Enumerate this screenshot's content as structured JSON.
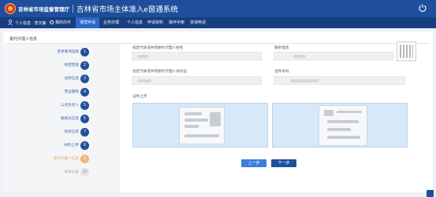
{
  "header": {
    "agency": "吉林省市场监督管理厅",
    "system_title": "吉林省市场主体准入e窗通系统"
  },
  "nav": {
    "user": "个人信息 · 李文静",
    "items": [
      {
        "label": "我的办件",
        "active": false
      },
      {
        "label": "准营申请",
        "active": true
      },
      {
        "label": "业务办理",
        "active": false
      },
      {
        "label": "个人信息",
        "active": false
      },
      {
        "label": "申请资料",
        "active": false
      },
      {
        "label": "操作手册",
        "active": false
      },
      {
        "label": "咨询电话",
        "active": false
      }
    ]
  },
  "panel": {
    "title": "委托代理人信息"
  },
  "steps": [
    {
      "label": "变更事项选择",
      "num": "1",
      "state": "done"
    },
    {
      "label": "经营范围",
      "num": "2",
      "state": "done"
    },
    {
      "label": "住所信息",
      "num": "3",
      "state": "done"
    },
    {
      "label": "营业期限",
      "num": "4",
      "state": "done"
    },
    {
      "label": "公司负责人",
      "num": "5",
      "state": "done"
    },
    {
      "label": "联络员信息",
      "num": "6",
      "state": "done"
    },
    {
      "label": "财务信息",
      "num": "7",
      "state": "done"
    },
    {
      "label": "材料上传",
      "num": "8",
      "state": "done"
    },
    {
      "label": "委托代理人信息",
      "num": "9",
      "state": "current"
    },
    {
      "label": "身份认证",
      "num": "10",
      "state": "pending"
    }
  ],
  "form": {
    "agent_name_label": "指定代表或共同委托代理人姓名",
    "contact_label": "联系电话",
    "agent_id_label": "指定代表或共同委托代理人身份证",
    "id_type_label": "证件号码",
    "upload_label": "证件上传"
  },
  "buttons": {
    "prev": "上一步",
    "next": "下一步"
  },
  "colors": {
    "header": "#1f4f9c",
    "nav": "#173e80",
    "step": "#234f98",
    "current": "#f2b37a"
  }
}
